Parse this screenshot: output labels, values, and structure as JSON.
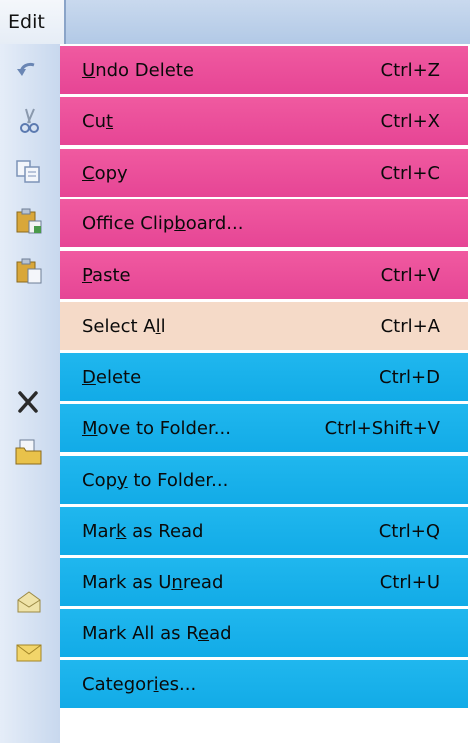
{
  "menubar": {
    "edit_label": "Edit"
  },
  "menu": {
    "items": [
      {
        "pre": "",
        "u": "U",
        "post": "ndo Delete",
        "shortcut": "Ctrl+Z",
        "icon": "undo-icon",
        "style": "pink"
      },
      {
        "pre": "Cu",
        "u": "t",
        "post": "",
        "shortcut": "Ctrl+X",
        "icon": "cut-icon",
        "style": "pink"
      },
      {
        "pre": "",
        "u": "C",
        "post": "opy",
        "shortcut": "Ctrl+C",
        "icon": "copy-icon",
        "style": "pink"
      },
      {
        "pre": "Office Clip",
        "u": "b",
        "post": "oard...",
        "shortcut": "",
        "icon": "office-clipboard-icon",
        "style": "pink"
      },
      {
        "pre": "",
        "u": "P",
        "post": "aste",
        "shortcut": "Ctrl+V",
        "icon": "paste-icon",
        "style": "pink"
      },
      {
        "pre": "Select A",
        "u": "l",
        "post": "l",
        "shortcut": "Ctrl+A",
        "icon": "",
        "style": "peach"
      },
      {
        "pre": "",
        "u": "D",
        "post": "elete",
        "shortcut": "Ctrl+D",
        "icon": "delete-icon",
        "style": "blue"
      },
      {
        "pre": "",
        "u": "M",
        "post": "ove to Folder...",
        "shortcut": "Ctrl+Shift+V",
        "icon": "move-to-folder-icon",
        "style": "blue"
      },
      {
        "pre": "Cop",
        "u": "y",
        "post": " to Folder...",
        "shortcut": "",
        "icon": "",
        "style": "blue"
      },
      {
        "pre": "Mar",
        "u": "k",
        "post": " as Read",
        "shortcut": "Ctrl+Q",
        "icon": "mark-read-icon",
        "style": "blue"
      },
      {
        "pre": "Mark as U",
        "u": "n",
        "post": "read",
        "shortcut": "Ctrl+U",
        "icon": "mark-unread-icon",
        "style": "blue"
      },
      {
        "pre": "Mark All as R",
        "u": "e",
        "post": "ad",
        "shortcut": "",
        "icon": "",
        "style": "blue"
      },
      {
        "pre": "Categor",
        "u": "i",
        "post": "es...",
        "shortcut": "",
        "icon": "",
        "style": "blue"
      }
    ]
  },
  "colors": {
    "pink": "#e84a98",
    "peach": "#f5dac8",
    "blue": "#18b0ea",
    "gutter": "#d4e1f2"
  }
}
